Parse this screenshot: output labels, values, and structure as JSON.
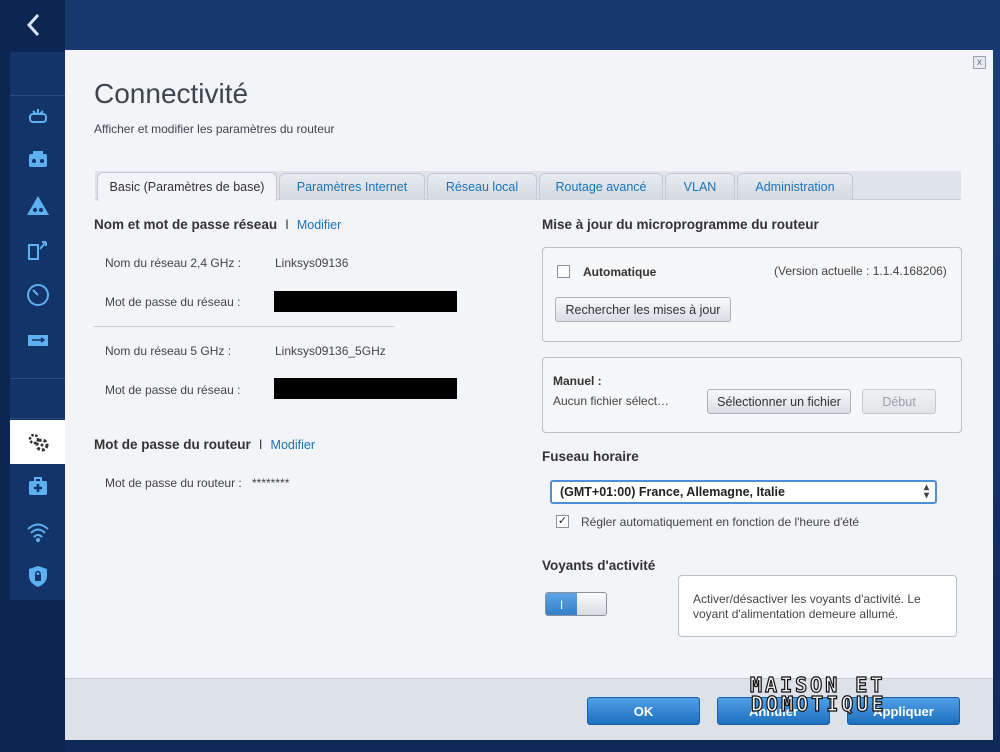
{
  "nav": {
    "back_icon": "chevron-left-icon",
    "items": [
      {
        "icon": "router-icon"
      },
      {
        "icon": "devices-icon"
      },
      {
        "icon": "parental-controls-icon"
      },
      {
        "icon": "media-prioritization-icon"
      },
      {
        "icon": "speed-test-icon"
      },
      {
        "icon": "usb-storage-icon"
      },
      {
        "icon": "connectivity-gear-icon"
      },
      {
        "icon": "troubleshooting-icon"
      },
      {
        "icon": "wireless-icon"
      },
      {
        "icon": "security-shield-icon"
      }
    ]
  },
  "dialog": {
    "close_label": "x",
    "title": "Connectivité",
    "subtitle": "Afficher et modifier les paramètres du routeur"
  },
  "tabs": [
    {
      "label": "Basic (Paramètres de base)",
      "active": true
    },
    {
      "label": "Paramètres Internet",
      "active": false
    },
    {
      "label": "Réseau local",
      "active": false
    },
    {
      "label": "Routage avancé",
      "active": false
    },
    {
      "label": "VLAN",
      "active": false
    },
    {
      "label": "Administration",
      "active": false
    }
  ],
  "network": {
    "title": "Nom et mot de passe réseau",
    "sep": "I",
    "edit_label": "Modifier",
    "ssid24_label": "Nom du réseau 2,4 GHz :",
    "ssid24_value": "Linksys09136",
    "pw24_label": "Mot de passe du réseau :",
    "ssid5_label": "Nom du réseau 5 GHz :",
    "ssid5_value": "Linksys09136_5GHz",
    "pw5_label": "Mot de passe du réseau :"
  },
  "router_pw": {
    "title": "Mot de passe du routeur",
    "sep": "I",
    "edit_label": "Modifier",
    "label": "Mot de passe du routeur :",
    "value": "********"
  },
  "firmware": {
    "title": "Mise à jour du microprogramme du routeur",
    "auto_label": "Automatique",
    "auto_checked": false,
    "version": "(Version actuelle : 1.1.4.168206)",
    "check_button": "Rechercher les mises à jour",
    "manual_label": "Manuel :",
    "no_file": "Aucun fichier sélect…",
    "select_button": "Sélectionner un fichier",
    "start_button": "Début"
  },
  "timezone": {
    "title": "Fuseau horaire",
    "selected": "(GMT+01:00) France, Allemagne, Italie",
    "dst_label": "Régler automatiquement en fonction de l'heure d'été",
    "dst_checked": true
  },
  "leds": {
    "title": "Voyants d'activité",
    "toggle_on_label": "I",
    "info": "Activer/désactiver les voyants d'activité. Le voyant d'alimentation demeure allumé."
  },
  "footer": {
    "ok": "OK",
    "cancel": "Annuler",
    "apply": "Appliquer"
  },
  "watermark": {
    "line1": "MAISON ET",
    "line2": "DOMOTIQUE"
  }
}
